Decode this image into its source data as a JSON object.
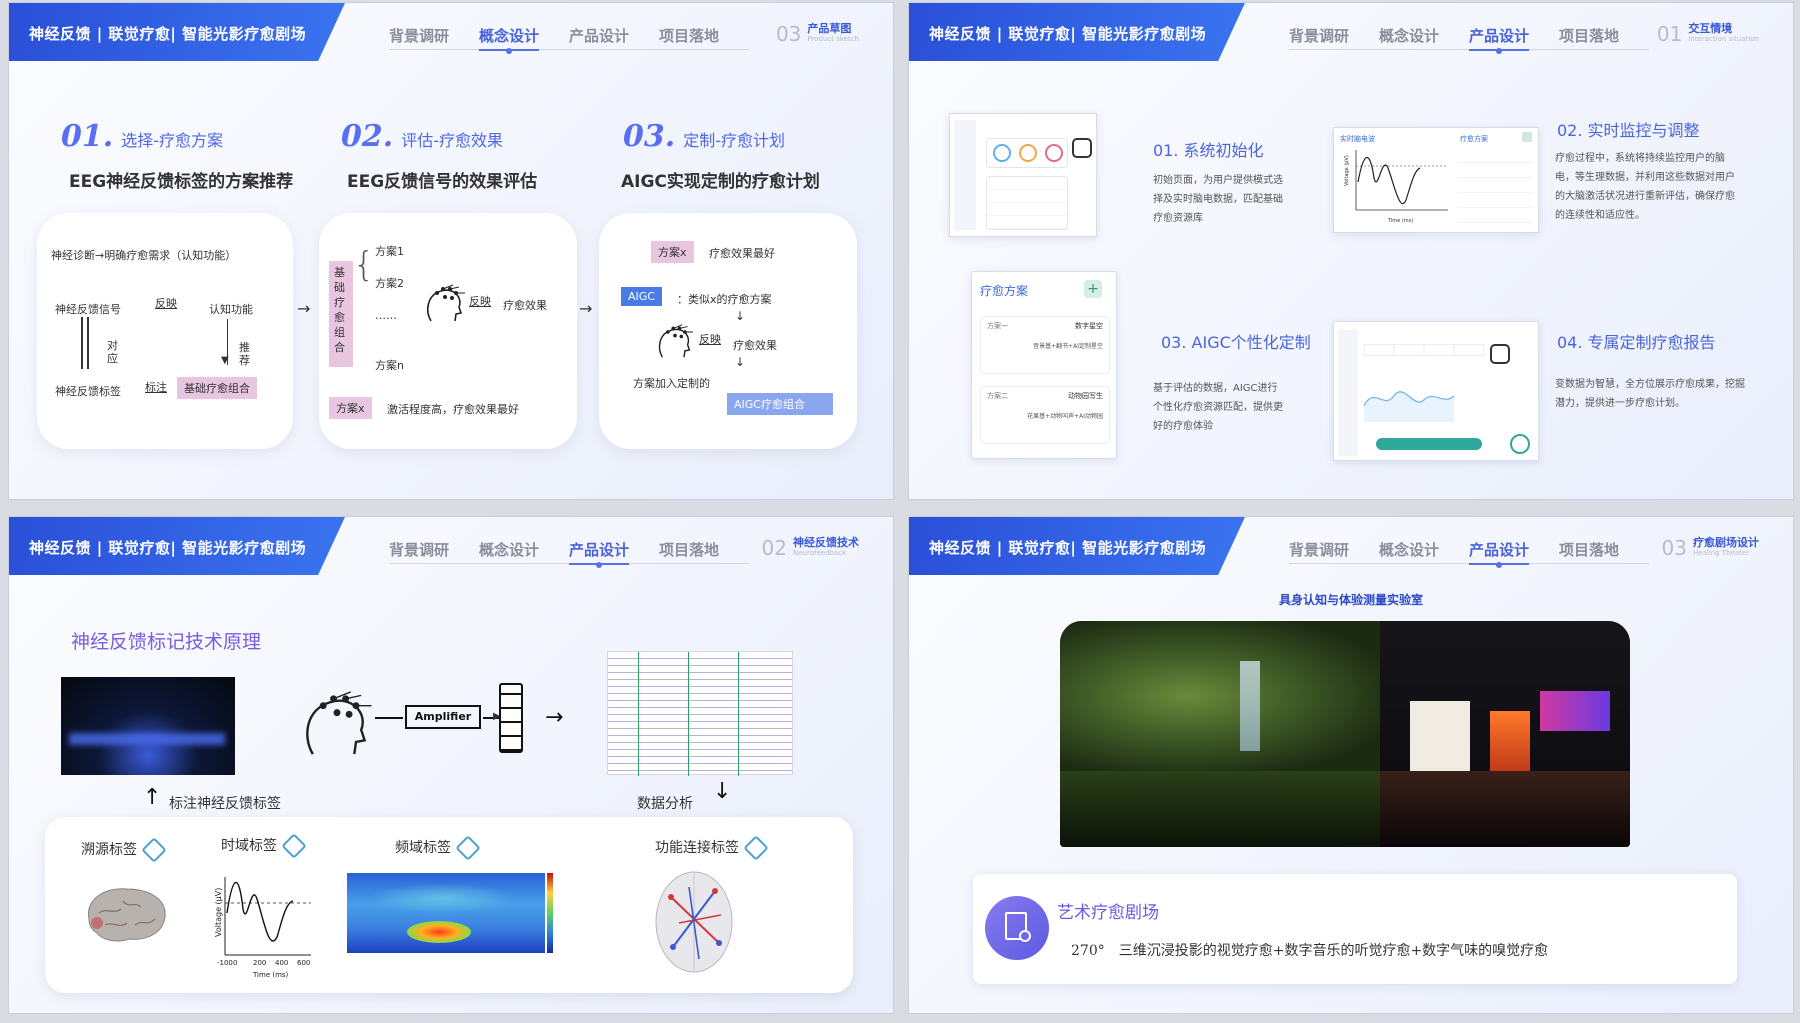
{
  "brand": "神经反馈 | 联觉疗愈| 智能光影疗愈剧场",
  "nav": [
    "背景调研",
    "概念设计",
    "产品设计",
    "项目落地"
  ],
  "slides": {
    "s1": {
      "active_nav": 1,
      "section": {
        "num": "03",
        "title": "产品草图",
        "sub": "Product sketch"
      },
      "steps": [
        {
          "num": "01.",
          "title": "选择-疗愈方案",
          "headline": "EEG神经反馈标签的方案推荐"
        },
        {
          "num": "02.",
          "title": "评估-疗愈效果",
          "headline": "EEG反馈信号的效果评估"
        },
        {
          "num": "03.",
          "title": "定制-疗愈计划",
          "headline": "AIGC实现定制的疗愈计划"
        }
      ],
      "card1": {
        "top": "神经诊断→明确疗愈需求（认知功能）",
        "signal": "神经反馈信号",
        "reflect": "反映",
        "cognition": "认知功能",
        "correspond": "对\n应",
        "recommend": "推\n荐",
        "label_tag": "神经反馈标签",
        "annotate": "标注",
        "base_combo": "基础疗愈组合"
      },
      "card2": {
        "side": "基础疗愈组合",
        "plans": [
          "方案1",
          "方案2",
          "……",
          "方案n"
        ],
        "reflect": "反映",
        "effect": "疗愈效果",
        "planx": "方案x",
        "desc": "激活程度高，疗愈效果最好"
      },
      "card3": {
        "planx": "方案x",
        "best": "疗愈效果最好",
        "aigc": "AIGC",
        "similar": "：类似x的疗愈方案",
        "reflect": "反映",
        "effect": "疗愈效果",
        "add": "方案加入定制的",
        "combo": "AIGC疗愈组合"
      }
    },
    "s2": {
      "active_nav": 2,
      "section": {
        "num": "01",
        "title": "交互情境",
        "sub": "Interaction situation"
      },
      "features": [
        {
          "title": "01.  系统初始化",
          "desc": "初始页面，为用户提供模式选择及实时脑电数据，匹配基础疗愈资源库"
        },
        {
          "title": "02.  实时监控与调整",
          "desc": "疗愈过程中，系统将持续监控用户的脑电，等生理数据，并利用这些数据对用户的大脑激活状况进行重新评估，确保疗愈的连续性和适应性。"
        },
        {
          "title": "03.  AIGC个性化定制",
          "desc": "基于评估的数据，AIGC进行个性化疗愈资源匹配，提供更好的疗愈体验"
        },
        {
          "title": "04.  专属定制疗愈报告",
          "desc": "变数据为智慧，全方位展示疗愈成果，挖掘潜力，提供进一步疗愈计划。"
        }
      ],
      "mock": {
        "plan_title": "疗愈方案",
        "plan1": "方案一",
        "plan1_name": "数字星空",
        "plan1_detail": "音景基+翻书+AI定制星空",
        "plan2": "方案二",
        "plan2_name": "动物园写生",
        "plan2_detail": "花果基+动物叫声+AI动物园",
        "eeg_title": "实时脑电波",
        "eeg_plan": "疗愈方案",
        "voltage": "Voltage (μV)",
        "time": "Time (ms)"
      }
    },
    "s3": {
      "active_nav": 2,
      "section": {
        "num": "02",
        "title": "神经反馈技术",
        "sub": "Neurofeedback"
      },
      "title": "神经反馈标记技术原理",
      "amplifier": "Amplifier",
      "annotate": "标注神经反馈标签",
      "analysis": "数据分析",
      "labels": [
        "溯源标签",
        "时域标签",
        "频域标签",
        "功能连接标签"
      ],
      "voltage": "Voltage (μV)",
      "time": "Time (ms)",
      "ticks_x": [
        "-100",
        "0",
        "200",
        "400",
        "600"
      ]
    },
    "s4": {
      "active_nav": 2,
      "section": {
        "num": "03",
        "title": "疗愈剧场设计",
        "sub": "Healing Theater"
      },
      "lab": "具身认知与体验测量实验室",
      "card_title": "艺术疗愈剧场",
      "card_desc": "270°　三维沉浸投影的视觉疗愈+数字音乐的听觉疗愈+数字气味的嗅觉疗愈"
    }
  },
  "colors": {
    "accent": "#4b63d8",
    "brand": "#2a4fd8",
    "pink": "#e7c3df",
    "violet": "#7a5de0"
  }
}
